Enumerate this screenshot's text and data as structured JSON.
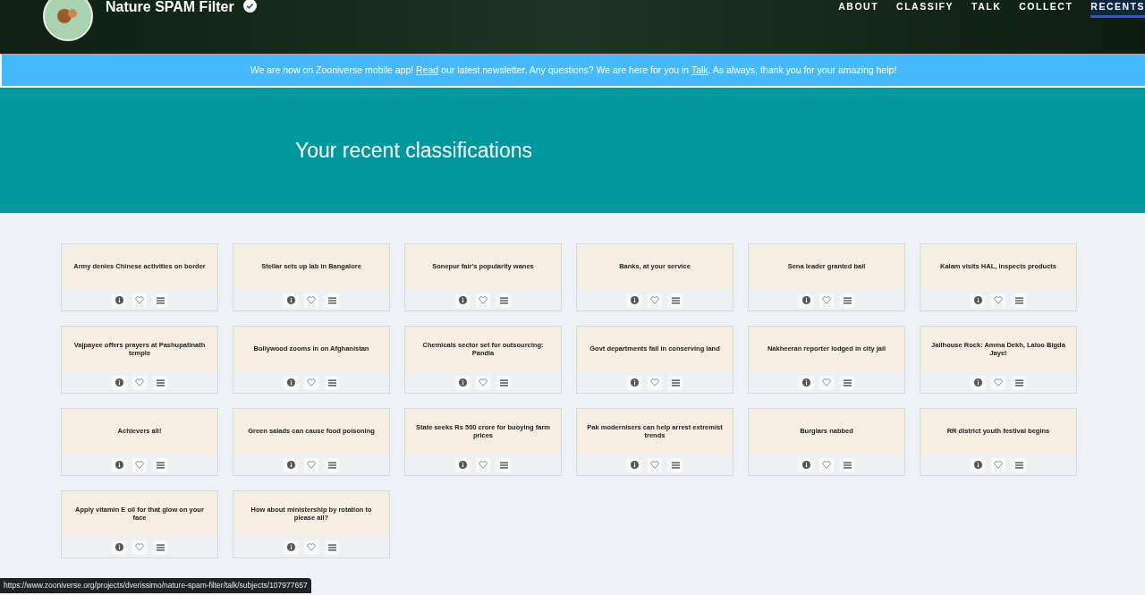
{
  "header": {
    "title": "Nature SPAM Filter",
    "nav": [
      {
        "label": "ABOUT",
        "selected": false
      },
      {
        "label": "CLASSIFY",
        "selected": false
      },
      {
        "label": "TALK",
        "selected": false
      },
      {
        "label": "COLLECT",
        "selected": false
      },
      {
        "label": "RECENTS",
        "selected": true
      }
    ]
  },
  "announcement": [
    {
      "kind": "text",
      "text": "We are now on Zooniverse mobile app! "
    },
    {
      "kind": "link",
      "text": "Read"
    },
    {
      "kind": "text",
      "text": " our latest newsletter. Any questions? We are here for you in "
    },
    {
      "kind": "link",
      "text": "Talk"
    },
    {
      "kind": "text",
      "text": ". As always, thank you for your amazing help!"
    }
  ],
  "hero": {
    "title": "Your recent classifications"
  },
  "classifications": [
    {
      "title": "Army denies Chinese activities on border"
    },
    {
      "title": "Stellar sets up lab in Bangalore"
    },
    {
      "title": "Sonepur fair's popularity wanes"
    },
    {
      "title": "Banks, at your service"
    },
    {
      "title": "Sena leader granted bail"
    },
    {
      "title": "Kalam visits HAL, inspects products"
    },
    {
      "title": "Vajpayee offers prayers at Pashupatinath temple"
    },
    {
      "title": "Bollywood zooms in on Afghanistan"
    },
    {
      "title": "Chemicals sector set for outsourcing: Pandia"
    },
    {
      "title": "Govt departments fail in conserving land"
    },
    {
      "title": "Nakheeran reporter lodged in city jail"
    },
    {
      "title": "Jailhouse Rock: Amma Dekh, Laloo Bigda Jaye!"
    },
    {
      "title": "Achievers all!"
    },
    {
      "title": "Green salads can cause food poisoning"
    },
    {
      "title": "State seeks Rs 500 crore for buoying farm prices"
    },
    {
      "title": "Pak modernisers can help arrest extremist trends"
    },
    {
      "title": "Burglars nabbed"
    },
    {
      "title": "RR district youth festival begins"
    },
    {
      "title": "Apply vitamin E oil for that glow on your face"
    },
    {
      "title": "How about ministership by rotation to please all?"
    }
  ],
  "status_bar": {
    "url": "https://www.zooniverse.org/projects/dverissimo/nature-spam-filter/talk/subjects/107977657"
  }
}
